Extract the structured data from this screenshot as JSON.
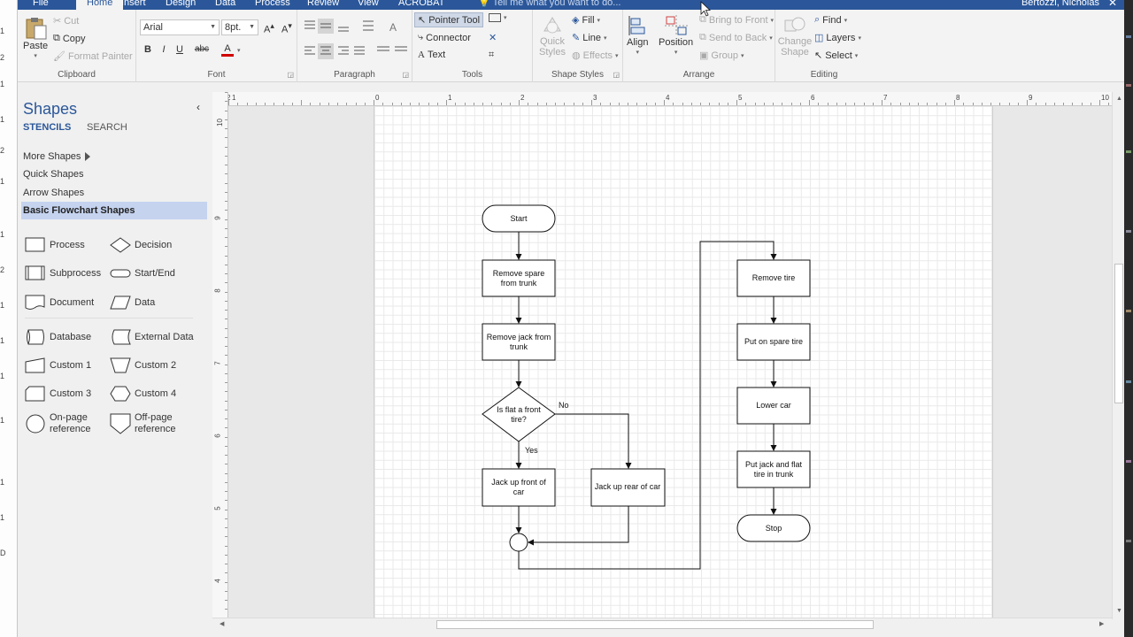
{
  "tabs": [
    "File",
    "Home",
    "Insert",
    "Design",
    "Data",
    "Process",
    "Review",
    "View",
    "ACROBAT"
  ],
  "tell_me": "Tell me what you want to do...",
  "user": "Bertozzi, Nicholas",
  "ribbon": {
    "clipboard": {
      "label": "Clipboard",
      "paste": "Paste",
      "cut": "Cut",
      "copy": "Copy",
      "format_painter": "Format Painter"
    },
    "font": {
      "label": "Font",
      "family": "Arial",
      "size": "8pt.",
      "bold": "B",
      "italic": "I",
      "underline": "U",
      "strike": "abc",
      "color": "A"
    },
    "paragraph": {
      "label": "Paragraph"
    },
    "tools": {
      "label": "Tools",
      "pointer": "Pointer Tool",
      "connector": "Connector",
      "text": "Text"
    },
    "shape_styles": {
      "label": "Shape Styles",
      "quick_styles": "Quick Styles",
      "fill": "Fill",
      "line": "Line",
      "effects": "Effects"
    },
    "arrange": {
      "label": "Arrange",
      "align": "Align",
      "position": "Position",
      "bring_front": "Bring to Front",
      "send_back": "Send to Back",
      "group": "Group"
    },
    "editing": {
      "label": "Editing",
      "change_shape": "Change Shape",
      "find": "Find",
      "layers": "Layers",
      "select": "Select"
    }
  },
  "shapes_pane": {
    "title": "Shapes",
    "stencils_tab": "STENCILS",
    "search_tab": "SEARCH",
    "items": [
      "More Shapes",
      "Quick Shapes",
      "Arrow Shapes",
      "Basic Flowchart Shapes"
    ],
    "stencils": [
      "Process",
      "Decision",
      "Subprocess",
      "Start/End",
      "Document",
      "Data",
      "Database",
      "External Data",
      "Custom 1",
      "Custom 2",
      "Custom 3",
      "Custom 4",
      "On-page reference",
      "Off-page reference"
    ]
  },
  "ruler_h": [
    "2",
    "1",
    "0",
    "1",
    "2",
    "3",
    "4",
    "5",
    "6",
    "7",
    "8",
    "9",
    "10"
  ],
  "ruler_v": [
    "10",
    "9",
    "8",
    "7",
    "6",
    "5",
    "4"
  ],
  "flowchart": {
    "start": "Start",
    "remove_spare": [
      "Remove spare",
      "from trunk"
    ],
    "remove_jack": [
      "Remove jack from",
      "trunk"
    ],
    "decision": [
      "Is flat a front",
      "tire?"
    ],
    "no": "No",
    "yes": "Yes",
    "jack_front": [
      "Jack up front of",
      "car"
    ],
    "jack_rear": "Jack up rear of car",
    "remove_tire": "Remove tire",
    "put_spare": "Put on spare tire",
    "lower_car": "Lower car",
    "put_jack": [
      "Put jack and flat",
      "tire in trunk"
    ],
    "stop": "Stop"
  }
}
